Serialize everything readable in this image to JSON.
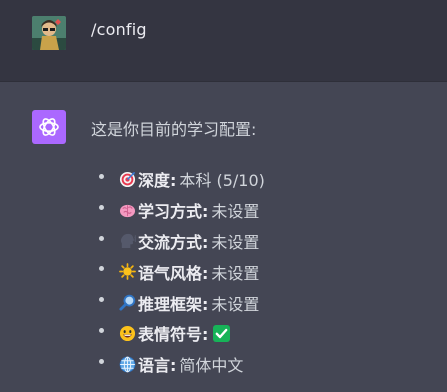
{
  "user": {
    "message": "/config"
  },
  "assistant": {
    "intro": "这是你目前的学习配置:",
    "items": [
      {
        "icon": "target-icon",
        "label": "深度:",
        "value": "本科 (5/10)"
      },
      {
        "icon": "brain-icon",
        "label": "学习方式:",
        "value": "未设置"
      },
      {
        "icon": "speech-head-icon",
        "label": "交流方式:",
        "value": "未设置"
      },
      {
        "icon": "sun-icon",
        "label": "语气风格:",
        "value": "未设置"
      },
      {
        "icon": "magnifier-icon",
        "label": "推理框架:",
        "value": "未设置"
      },
      {
        "icon": "smiley-icon",
        "label": "表情符号:",
        "value": ""
      },
      {
        "icon": "globe-icon",
        "label": "语言:",
        "value": "简体中文"
      }
    ],
    "emoji_value_icon": "check-mark-button-icon"
  },
  "colors": {
    "user_bg": "#343541",
    "assistant_bg": "#444654",
    "assistant_avatar": "#ab68ff",
    "check_green": "#17b358"
  }
}
